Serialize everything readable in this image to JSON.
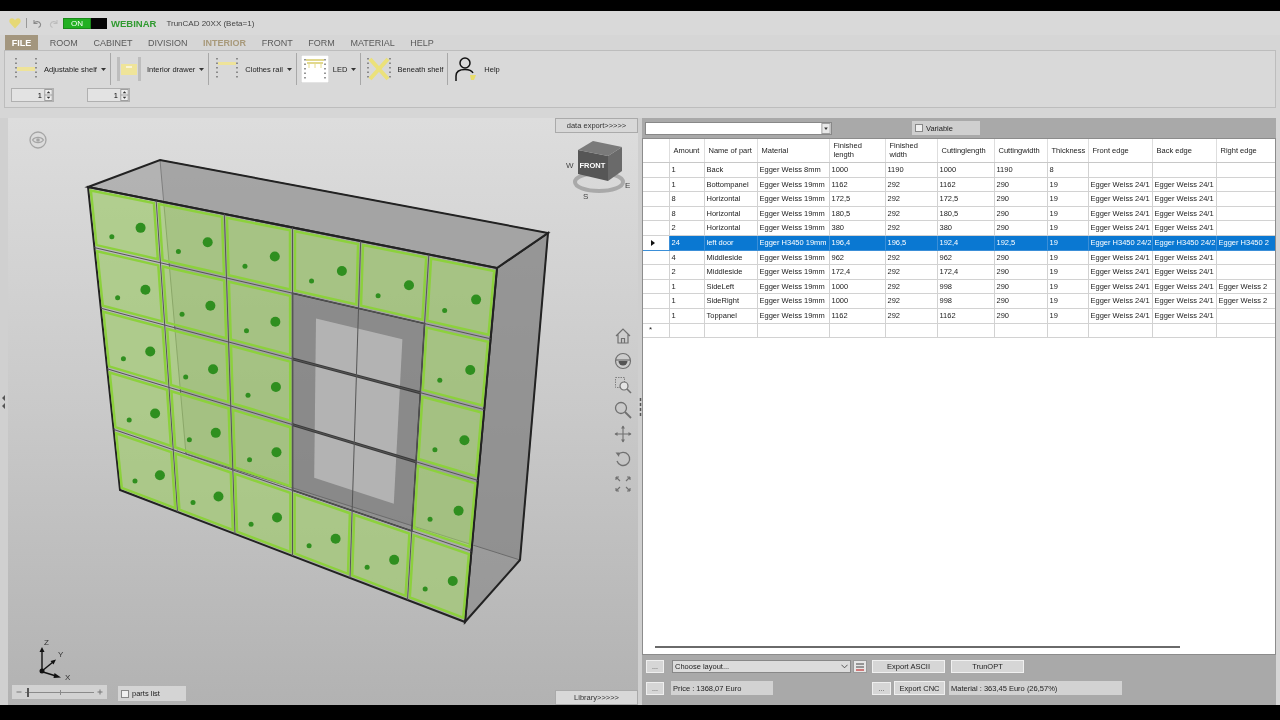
{
  "title_bar": {
    "toggle": {
      "label": "ON",
      "on": true
    },
    "brand": "WEBINAR",
    "title": "TrunCAD 20XX (Beta=1)"
  },
  "menu": {
    "file": "FILE",
    "tabs": [
      {
        "label": "ROOM",
        "selected": false
      },
      {
        "label": "CABINET",
        "selected": false
      },
      {
        "label": "DIVISION",
        "selected": false
      },
      {
        "label": "INTERIOR",
        "selected": true
      },
      {
        "label": "FRONT",
        "selected": false
      },
      {
        "label": "FORM",
        "selected": false
      },
      {
        "label": "MATERIAL",
        "selected": false
      },
      {
        "label": "HELP",
        "selected": false
      }
    ]
  },
  "ribbon": {
    "tools": [
      {
        "kind": "shelf",
        "label": "Adjustable shelf",
        "dropdown": true,
        "selected": false
      },
      {
        "kind": "drawer",
        "label": "Interior drawer",
        "dropdown": true,
        "selected": false
      },
      {
        "kind": "rail",
        "label": "Clothes rail",
        "dropdown": true,
        "selected": false
      },
      {
        "kind": "led",
        "label": "LED",
        "dropdown": true,
        "selected": true
      },
      {
        "kind": "beneath",
        "label": "Beneath shelf",
        "dropdown": false,
        "selected": false
      },
      {
        "kind": "help",
        "label": "Help",
        "dropdown": false,
        "selected": false
      }
    ],
    "spinners": [
      "1",
      "1"
    ]
  },
  "viewer": {
    "export_tab": "data export>>>>>",
    "view_cube": {
      "face": "FRONT",
      "compass": [
        "W",
        "S",
        "E"
      ]
    },
    "axes": [
      "Z",
      "Y",
      "X"
    ],
    "zoom_slider": {
      "level": 0.05
    },
    "parts_list": {
      "label": "parts list",
      "checked": false
    },
    "library_button": "Library>>>>>"
  },
  "parts_panel": {
    "variable": {
      "label": "Variable",
      "checked": false
    },
    "table": {
      "columns": [
        "Amount",
        "Name of part",
        "Material",
        "Finished length",
        "Finished width",
        "Cuttinglength",
        "Cuttingwidth",
        "Thickness",
        "Front edge",
        "Back edge",
        "Right edge"
      ],
      "rows": [
        {
          "cells": [
            "1",
            "Back",
            "Egger Weiss 8mm",
            "1000",
            "1190",
            "1000",
            "1190",
            "8",
            null,
            null,
            null
          ],
          "selected": false
        },
        {
          "cells": [
            "1",
            "Bottompanel",
            "Egger Weiss 19mm",
            "1162",
            "292",
            "1162",
            "290",
            "19",
            "Egger Weiss 24/1",
            "Egger Weiss 24/1",
            null
          ],
          "selected": false
        },
        {
          "cells": [
            "8",
            "Horizontal",
            "Egger Weiss 19mm",
            "172,5",
            "292",
            "172,5",
            "290",
            "19",
            "Egger Weiss 24/1",
            "Egger Weiss 24/1",
            null
          ],
          "selected": false
        },
        {
          "cells": [
            "8",
            "Horizontal",
            "Egger Weiss 19mm",
            "180,5",
            "292",
            "180,5",
            "290",
            "19",
            "Egger Weiss 24/1",
            "Egger Weiss 24/1",
            null
          ],
          "selected": false
        },
        {
          "cells": [
            "2",
            "Horizontal",
            "Egger Weiss 19mm",
            "380",
            "292",
            "380",
            "290",
            "19",
            "Egger Weiss 24/1",
            "Egger Weiss 24/1",
            null
          ],
          "selected": false
        },
        {
          "cells": [
            "24",
            "left door",
            "Egger H3450 19mm",
            "196,4",
            "196,5",
            "192,4",
            "192,5",
            "19",
            "Egger H3450 24/2",
            "Egger H3450 24/2",
            "Egger H3450 2"
          ],
          "selected": true
        },
        {
          "cells": [
            "4",
            "Middleside",
            "Egger Weiss 19mm",
            "962",
            "292",
            "962",
            "290",
            "19",
            "Egger Weiss 24/1",
            "Egger Weiss 24/1",
            null
          ],
          "selected": false
        },
        {
          "cells": [
            "2",
            "Middleside",
            "Egger Weiss 19mm",
            "172,4",
            "292",
            "172,4",
            "290",
            "19",
            "Egger Weiss 24/1",
            "Egger Weiss 24/1",
            null
          ],
          "selected": false
        },
        {
          "cells": [
            "1",
            "SideLeft",
            "Egger Weiss 19mm",
            "1000",
            "292",
            "998",
            "290",
            "19",
            "Egger Weiss 24/1",
            "Egger Weiss 24/1",
            "Egger Weiss 2"
          ],
          "selected": false
        },
        {
          "cells": [
            "1",
            "SideRight",
            "Egger Weiss 19mm",
            "1000",
            "292",
            "998",
            "290",
            "19",
            "Egger Weiss 24/1",
            "Egger Weiss 24/1",
            "Egger Weiss 2"
          ],
          "selected": false
        },
        {
          "cells": [
            "1",
            "Toppanel",
            "Egger Weiss 19mm",
            "1162",
            "292",
            "1162",
            "290",
            "19",
            "Egger Weiss 24/1",
            "Egger Weiss 24/1",
            null
          ],
          "selected": false
        }
      ],
      "new_row_marker": "*"
    }
  },
  "bottom_bar": {
    "more_buttons": [
      "...",
      "...",
      "..."
    ],
    "layout_select": {
      "value": "Choose layout..."
    },
    "export_ascii": "Export ASCII",
    "trunopt": "TrunOPT",
    "price": "Price : 1368,07 Euro",
    "export_cnc": "Export CNC",
    "material_cost": "Material : 363,45 Euro (26,57%)"
  }
}
